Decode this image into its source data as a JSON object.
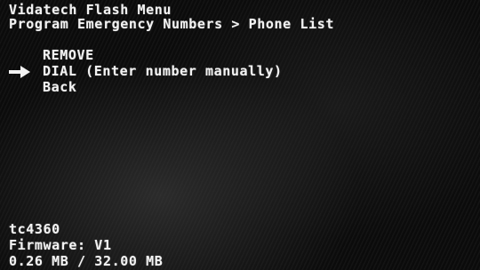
{
  "header": {
    "title": "Vidatech Flash Menu",
    "breadcrumb": "Program Emergency Numbers > Phone List"
  },
  "menu": {
    "items": [
      {
        "label": "REMOVE"
      },
      {
        "label": "DIAL (Enter number manually)"
      },
      {
        "label": "Back"
      }
    ],
    "selected_index": 1
  },
  "selector_icon": "right-arrow-icon",
  "footer": {
    "device": "tc4360",
    "firmware": "Firmware: V1",
    "memory": "0.26 MB / 32.00 MB"
  },
  "colors": {
    "text": "#f2f2f2",
    "background": "#000000"
  }
}
